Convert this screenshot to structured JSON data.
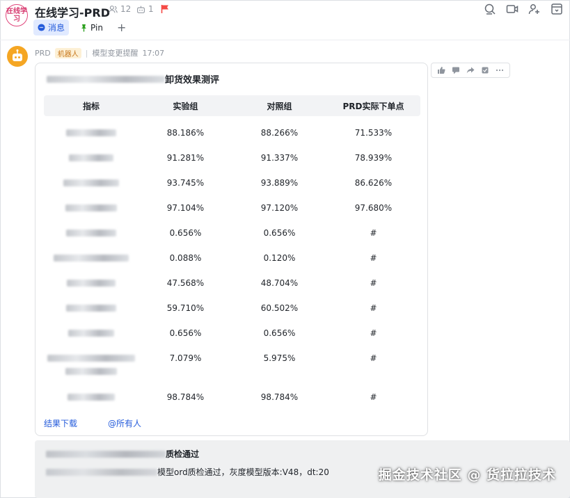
{
  "header": {
    "avatar_text": "在线学习",
    "title": "在线学习-PRD",
    "member_count": "12",
    "bot_count": "1"
  },
  "tabs": [
    {
      "label": "消息",
      "active": true
    },
    {
      "label": "Pin",
      "active": false
    },
    {
      "label": "+",
      "active": false
    }
  ],
  "message": {
    "sender": "PRD",
    "bot_badge": "机器人",
    "subject": "模型变更提醒",
    "time": "17:07"
  },
  "card": {
    "title_suffix": "卸货效果测评",
    "columns": [
      "指标",
      "实验组",
      "对照组",
      "PRD实际下单点"
    ],
    "rows": [
      {
        "exp": "88.186%",
        "ctrl": "88.266%",
        "prd": "71.533%"
      },
      {
        "exp": "91.281%",
        "ctrl": "91.337%",
        "prd": "78.939%"
      },
      {
        "exp": "93.745%",
        "ctrl": "93.889%",
        "prd": "86.626%"
      },
      {
        "exp": "97.104%",
        "ctrl": "97.120%",
        "prd": "97.680%"
      },
      {
        "exp": "0.656%",
        "ctrl": "0.656%",
        "prd": "#"
      },
      {
        "exp": "0.088%",
        "ctrl": "0.120%",
        "prd": "#"
      },
      {
        "exp": "47.568%",
        "ctrl": "48.704%",
        "prd": "#"
      },
      {
        "exp": "59.710%",
        "ctrl": "60.502%",
        "prd": "#"
      },
      {
        "exp": "0.656%",
        "ctrl": "0.656%",
        "prd": "#"
      },
      {
        "exp": "7.079%",
        "ctrl": "5.975%",
        "prd": "#"
      },
      {
        "exp": "98.784%",
        "ctrl": "98.784%",
        "prd": "#"
      }
    ],
    "link_download": "结果下载",
    "link_mention": "@所有人"
  },
  "card2": {
    "title_suffix": "质检通过",
    "body": "模型ord质检通过，灰度模型版本:V48，dt:20"
  },
  "footer_watermark": "掘金技术社区 @ 货拉拉技术",
  "colors": {
    "accent": "#245bdb",
    "bot_avatar": "#f5a623",
    "flag": "#f54a45"
  }
}
